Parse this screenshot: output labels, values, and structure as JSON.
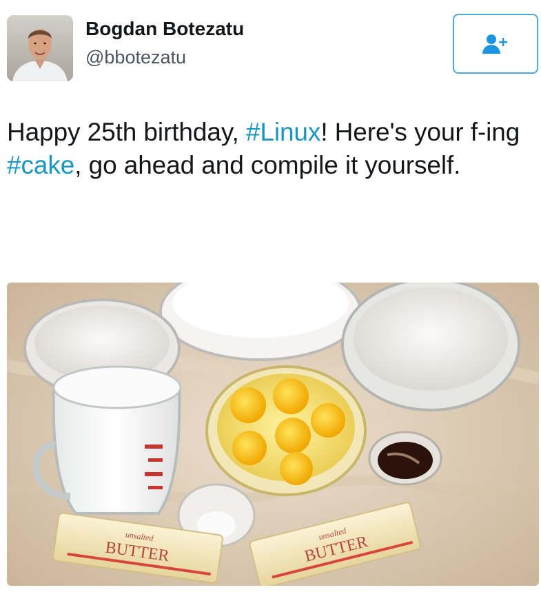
{
  "user": {
    "name": "Bogdan Botezatu",
    "handle": "@bbotezatu",
    "avatar_icon": "person-photo"
  },
  "follow_button": {
    "icon": "add-user-icon",
    "color": "#4aa9dd"
  },
  "tweet": {
    "text_parts": {
      "p1": "Happy 25th birthday, ",
      "tag1": "#Linux",
      "p2": "! Here's your f-ing ",
      "tag2": "#cake",
      "p3": ", go ahead and compile it yourself."
    },
    "hashtag_color": "#1b95c2"
  },
  "media": {
    "butter_label_left": "BUTTER",
    "butter_label_right": "BUTTER",
    "butter_sub_left": "unsalted",
    "butter_sub_right": "unsalted"
  }
}
